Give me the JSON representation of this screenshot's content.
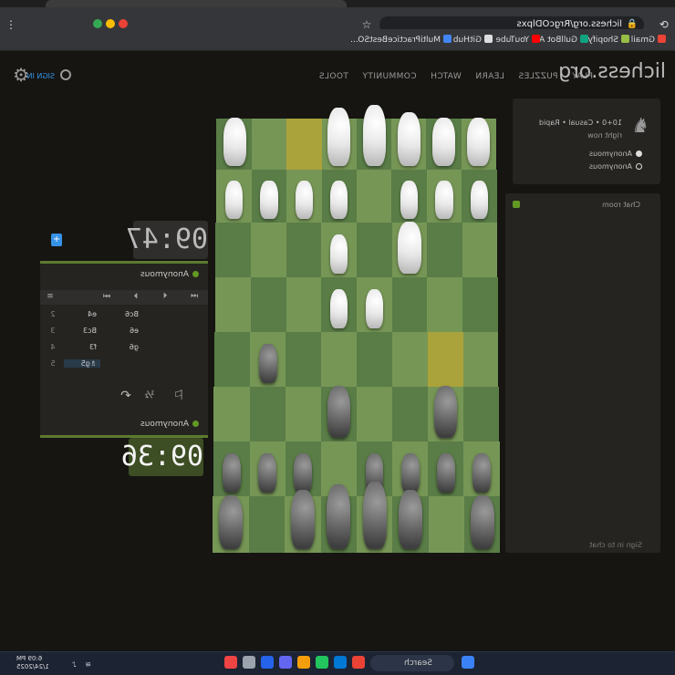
{
  "browser": {
    "url": "lichess.org/RrgcODlpxs",
    "bookmarks": [
      "Gmail",
      "Shopify",
      "GullBot AI",
      "YouTube",
      "GitHub",
      "MultiPracticeBestSO..."
    ]
  },
  "header": {
    "logo": "lichess.org",
    "nav": [
      "PLAY",
      "PUZZLES",
      "LEARN",
      "WATCH",
      "COMMUNITY",
      "TOOLS"
    ],
    "signin": "SIGN IN"
  },
  "game_info": {
    "mode": "10+0 • Casual • Rapid",
    "when": "right now",
    "players": [
      "Anonymous",
      "Anonymous"
    ]
  },
  "chat": {
    "title": "Chat room",
    "signin_prompt": "Sign in to chat"
  },
  "clocks": {
    "top": "09:47",
    "bottom": "09:36"
  },
  "players": {
    "top": "Anonymous",
    "bottom": "Anonymous"
  },
  "moves": [
    {
      "n": "2",
      "white": "e4",
      "black": "Bc6"
    },
    {
      "n": "3",
      "white": "Bc3",
      "black": "e6"
    },
    {
      "n": "4",
      "white": "f3",
      "black": "g6"
    },
    {
      "n": "5",
      "white": "♗g5",
      "black": ""
    }
  ],
  "taskbar": {
    "search": "Search",
    "time": "6:09 PM",
    "date": "1/24/2025"
  },
  "colors": {
    "board_light": "#769656",
    "board_dark": "#5a7d47",
    "highlight": "#aaa23a",
    "accent": "#629924"
  }
}
